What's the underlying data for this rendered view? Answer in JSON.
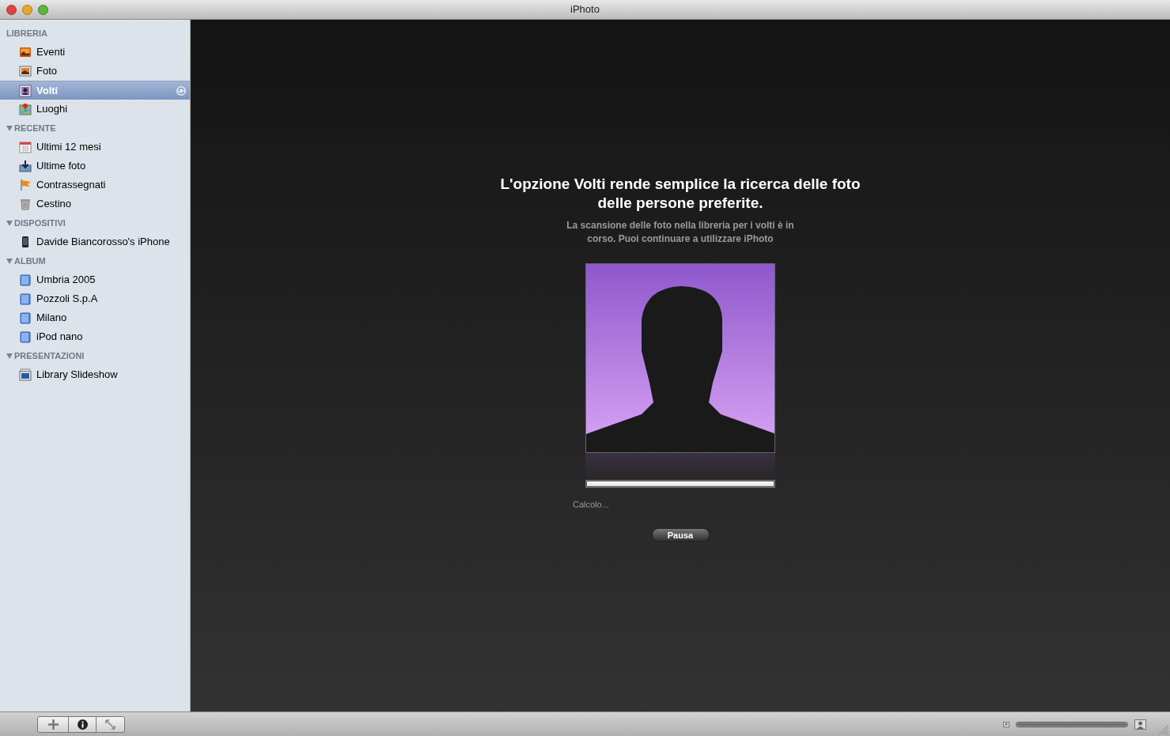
{
  "window": {
    "title": "iPhoto"
  },
  "sidebar": {
    "sections": [
      {
        "title": "LIBRERIA",
        "items": [
          {
            "label": "Eventi",
            "kind": "events",
            "selected": false,
            "busy": false
          },
          {
            "label": "Foto",
            "kind": "photos",
            "selected": false,
            "busy": false
          },
          {
            "label": "Volti",
            "kind": "faces",
            "selected": true,
            "busy": true
          },
          {
            "label": "Luoghi",
            "kind": "places",
            "selected": false,
            "busy": false
          }
        ]
      },
      {
        "title": "RECENTE",
        "expanded": true,
        "items": [
          {
            "label": "Ultimi 12 mesi",
            "kind": "calendar",
            "selected": false,
            "busy": false
          },
          {
            "label": "Ultime foto",
            "kind": "import",
            "selected": false,
            "busy": false
          },
          {
            "label": "Contrassegnati",
            "kind": "flag",
            "selected": false,
            "busy": false
          },
          {
            "label": "Cestino",
            "kind": "trash",
            "selected": false,
            "busy": false
          }
        ]
      },
      {
        "title": "DISPOSITIVI",
        "expanded": true,
        "items": [
          {
            "label": "Davide Biancorosso's iPhone",
            "kind": "phone",
            "selected": false,
            "busy": false
          }
        ]
      },
      {
        "title": "ALBUM",
        "expanded": true,
        "items": [
          {
            "label": "Umbria 2005",
            "kind": "album",
            "selected": false,
            "busy": false
          },
          {
            "label": "Pozzoli S.p.A",
            "kind": "album",
            "selected": false,
            "busy": false
          },
          {
            "label": "Milano",
            "kind": "album",
            "selected": false,
            "busy": false
          },
          {
            "label": "iPod nano",
            "kind": "album",
            "selected": false,
            "busy": false
          }
        ]
      },
      {
        "title": "PRESENTAZIONI",
        "expanded": true,
        "items": [
          {
            "label": "Library Slideshow",
            "kind": "slideshow",
            "selected": false,
            "busy": false
          }
        ]
      }
    ]
  },
  "main": {
    "heading": "L'opzione Volti rende semplice la ricerca delle foto delle persone preferite.",
    "description": "La scansione delle foto nella libreria per i volti è in corso. Puoi continuare a utilizzare iPhoto",
    "progress": {
      "level": 1,
      "status": "Calcolo..."
    },
    "pause_button": "Pausa"
  },
  "zoom_slider": {
    "level": 1
  }
}
